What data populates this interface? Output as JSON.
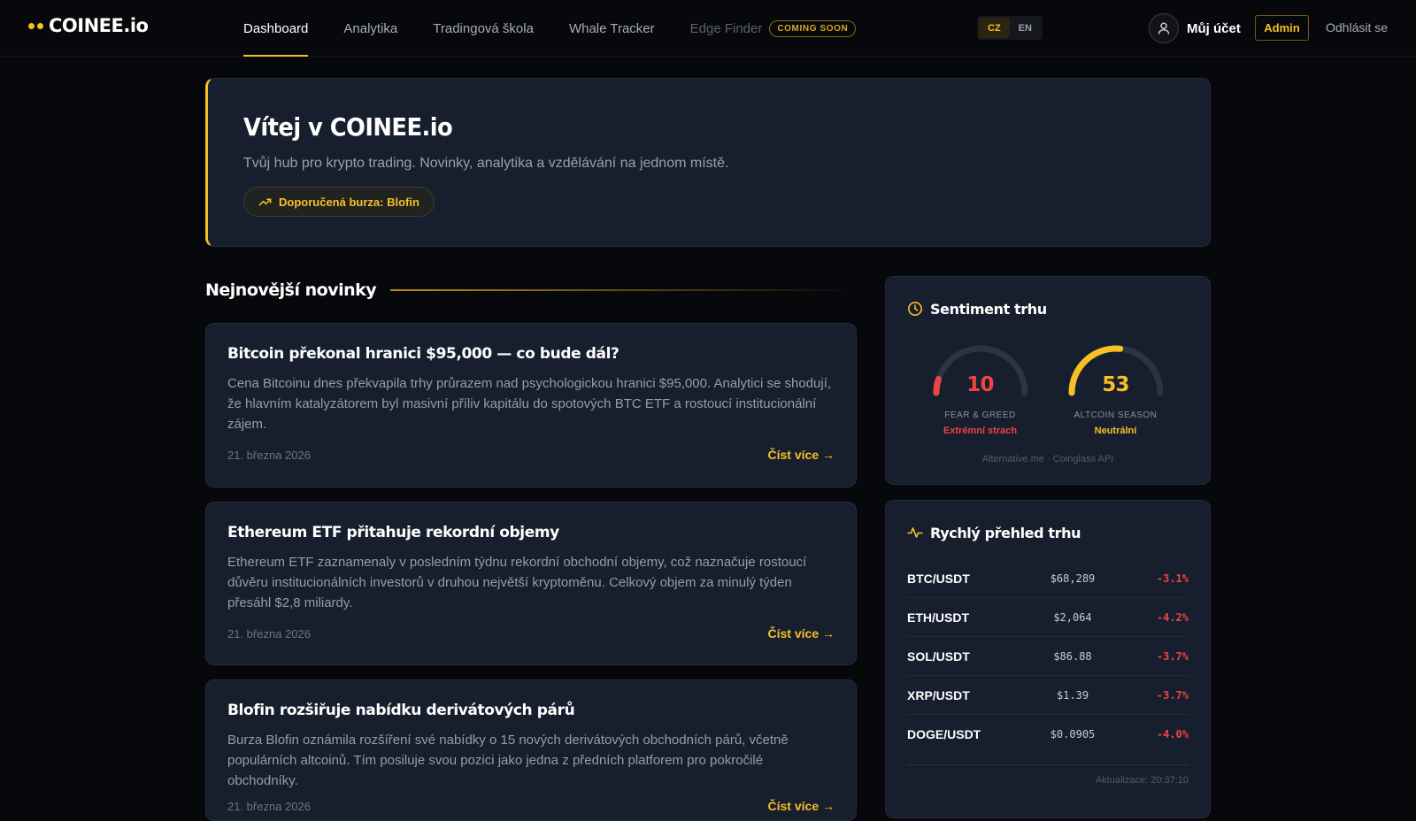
{
  "brand": {
    "name": "COINEE.io",
    "accent": "#f6c026"
  },
  "nav": {
    "items": [
      {
        "label": "Dashboard",
        "state": "active"
      },
      {
        "label": "Analytika",
        "state": "normal"
      },
      {
        "label": "Tradingová škola",
        "state": "normal"
      },
      {
        "label": "Whale Tracker",
        "state": "normal"
      },
      {
        "label": "Edge Finder",
        "state": "disabled"
      }
    ],
    "coming_soon": "COMING SOON"
  },
  "language": {
    "options": [
      "CZ",
      "EN"
    ],
    "selected": "CZ"
  },
  "account": {
    "label": "Můj účet",
    "admin": "Admin",
    "logout": "Odhlásit se"
  },
  "hero": {
    "title": "Vítej v COINEE.io",
    "subtitle": "Tvůj hub pro krypto trading. Novinky, analytika a vzdělávání na jednom místě.",
    "badge": "Doporučená burza: Blofin"
  },
  "news": {
    "heading": "Nejnovější novinky",
    "read_more": "Číst více →",
    "items": [
      {
        "title": "Bitcoin překonal hranici $95,000 — co bude dál?",
        "body": "Cena Bitcoinu dnes překvapila trhy průrazem nad psychologickou hranici $95,000. Analytici se shodují, že hlavním katalyzátorem byl masivní příliv kapitálu do spotových BTC ETF a rostoucí institucionální zájem.",
        "date": "21. března 2026"
      },
      {
        "title": "Ethereum ETF přitahuje rekordní objemy",
        "body": "Ethereum ETF zaznamenaly v posledním týdnu rekordní obchodní objemy, což naznačuje rostoucí důvěru institucionálních investorů v druhou největší kryptoměnu. Celkový objem za minulý týden přesáhl $2,8 miliardy.",
        "date": "21. března 2026"
      },
      {
        "title": "Blofin rozšiřuje nabídku derivátových párů",
        "body": "Burza Blofin oznámila rozšíření své nabídky o 15 nových derivátových obchodních párů, včetně populárních altcoinů. Tím posiluje svou pozici jako jedna z předních platforem pro pokročilé obchodníky.",
        "date": "21. března 2026"
      }
    ]
  },
  "sentiment": {
    "title": "Sentiment trhu",
    "gauges": [
      {
        "value": 10,
        "max": 100,
        "label": "FEAR & GREED",
        "status": "Extrémní strach",
        "color": "#ef4444"
      },
      {
        "value": 53,
        "max": 100,
        "label": "ALTCOIN SEASON",
        "status": "Neutrální",
        "color": "#f6c026"
      }
    ],
    "sources": "Alternative.me · Coinglass API"
  },
  "market": {
    "title": "Rychlý přehled trhu",
    "rows": [
      {
        "pair": "BTC/USDT",
        "price": "$68,289",
        "change": "-3.1%"
      },
      {
        "pair": "ETH/USDT",
        "price": "$2,064",
        "change": "-4.2%"
      },
      {
        "pair": "SOL/USDT",
        "price": "$86.88",
        "change": "-3.7%"
      },
      {
        "pair": "XRP/USDT",
        "price": "$1.39",
        "change": "-3.7%"
      },
      {
        "pair": "DOGE/USDT",
        "price": "$0.0905",
        "change": "-4.0%"
      }
    ],
    "updated": "Aktualizace: 20:37:10"
  }
}
